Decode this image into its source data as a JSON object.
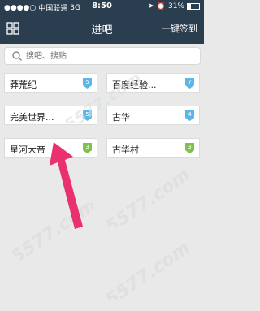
{
  "status_bar": {
    "carrier": "中国联通",
    "network": "3G",
    "time": "8:50",
    "battery": "31%",
    "battery_level": 0.31
  },
  "nav": {
    "title": "进吧",
    "sign_in_all": "一键签到",
    "menu_icon": "grid-icon"
  },
  "search": {
    "placeholder": "搜吧、搜贴",
    "icon": "search-icon"
  },
  "bars": [
    {
      "name": "莽荒纪",
      "level": "5",
      "badge_color": "#5ab7e6"
    },
    {
      "name": "百度经验...",
      "level": "7",
      "badge_color": "#5ab7e6"
    },
    {
      "name": "完美世界...",
      "level": "5",
      "badge_color": "#5ab7e6"
    },
    {
      "name": "古华",
      "level": "4",
      "badge_color": "#5ab7e6"
    },
    {
      "name": "星河大帝",
      "level": "3",
      "badge_color": "#7fc04e"
    },
    {
      "name": "古华村",
      "level": "3",
      "badge_color": "#7fc04e"
    }
  ],
  "accent_color": "#e8316e",
  "watermark_text": "5577.com"
}
